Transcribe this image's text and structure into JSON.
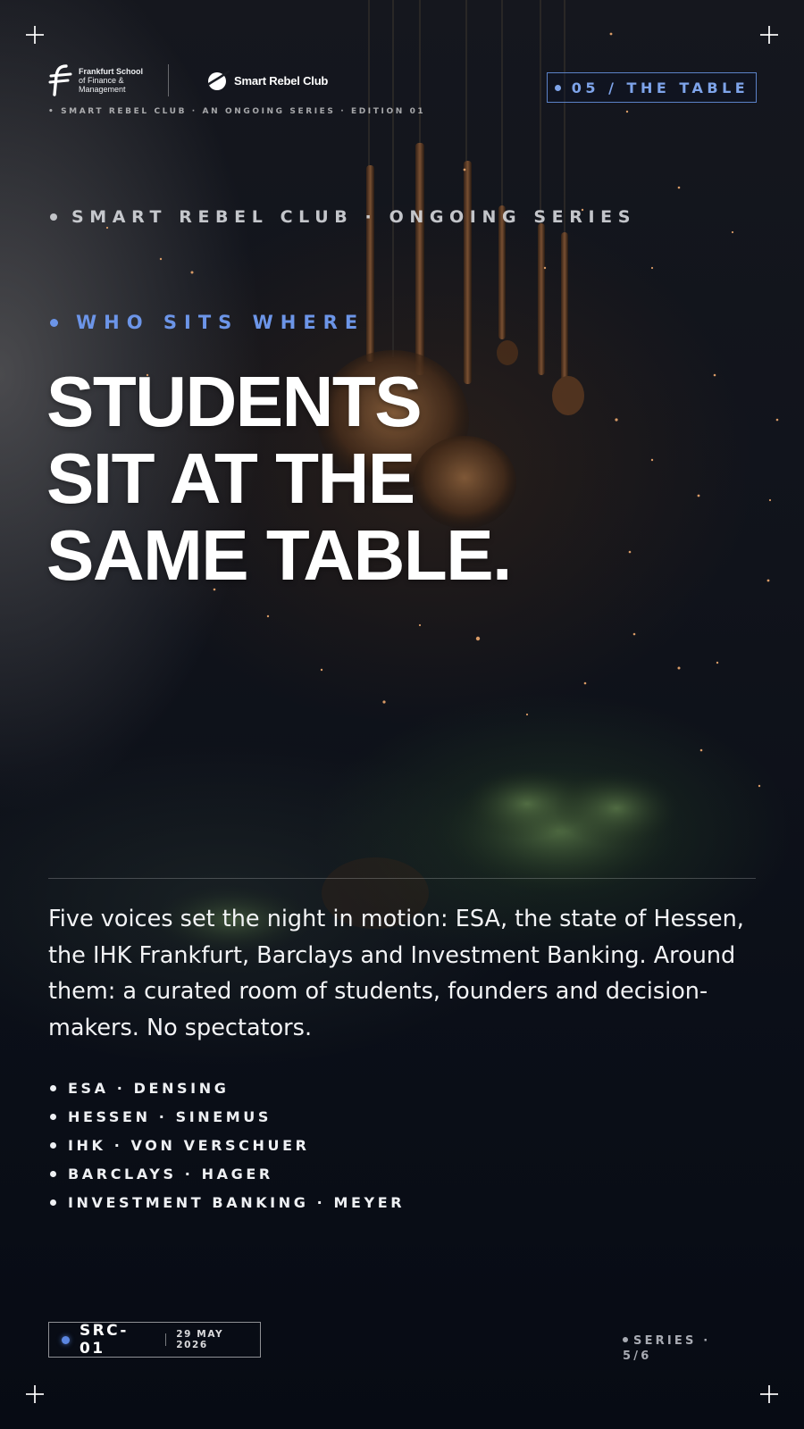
{
  "branding": {
    "school_name_lines": [
      "Frankfurt School",
      "of Finance &",
      "Management"
    ],
    "club_name": "Smart Rebel Club",
    "tagline": "• SMART REBEL CLUB · AN ONGOING SERIES · EDITION 01"
  },
  "chapter_badge": "05 / THE TABLE",
  "series_heading": "SMART REBEL CLUB · ONGOING SERIES",
  "eyebrow": "WHO SITS WHERE",
  "headline_lines": [
    "STUDENTS",
    "SIT AT THE",
    "SAME TABLE."
  ],
  "lede": "Five voices set the night in motion: ESA, the state of Hessen, the IHK Frankfurt, Barclays and Investment Banking. Around them: a curated room of students, founders and decision-makers. No spectators.",
  "voices": [
    "ESA · DENSING",
    "HESSEN · SINEMUS",
    "IHK · VON VERSCHUER",
    "BARCLAYS · HAGER",
    "INVESTMENT BANKING · MEYER"
  ],
  "footer": {
    "code": "SRC-01",
    "date": "29 MAY 2026",
    "series_label": "SERIES ·",
    "series_position": "5/6"
  },
  "colors": {
    "accent": "#6c95e8",
    "badge_border": "#5b82c8",
    "background": "#0b0f18"
  },
  "icons": {
    "school_logo": "frankfurt-school-f-icon",
    "club_logo": "smart-rebel-swoosh-icon",
    "corners": "crosshair-icon"
  }
}
